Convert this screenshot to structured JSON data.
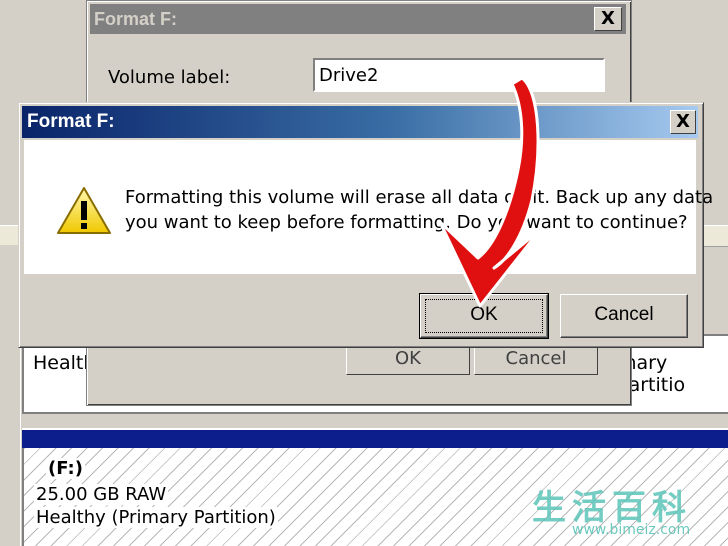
{
  "background": {
    "upper_row": {
      "left_text": "Health",
      "right_text": "mary Partitio"
    },
    "disk": {
      "letter": "(F:)",
      "size": "25.00 GB RAW",
      "status": "Healthy (Primary Partition)"
    }
  },
  "back_dialog": {
    "title": "Format F:",
    "close_label": "X",
    "volume_label_text": "Volume label:",
    "volume_label_value": "Drive2",
    "ok_label": "OK",
    "cancel_label": "Cancel"
  },
  "dialog": {
    "title": "Format F:",
    "close_label": "X",
    "message_line1": "Formatting this volume will erase all data on it. Back up any data",
    "message_line2": "you want to keep before formatting. Do you want to continue?",
    "icon": "warning-icon",
    "ok_label": "OK",
    "cancel_label": "Cancel"
  },
  "colors": {
    "title_active_start": "#0a246a",
    "title_active_end": "#a6caf0",
    "arrow": "#e01010",
    "volume_bar": "#0b1e8c"
  },
  "watermark": {
    "chinese": "生活百科",
    "url": "www.bimeiz.com"
  }
}
